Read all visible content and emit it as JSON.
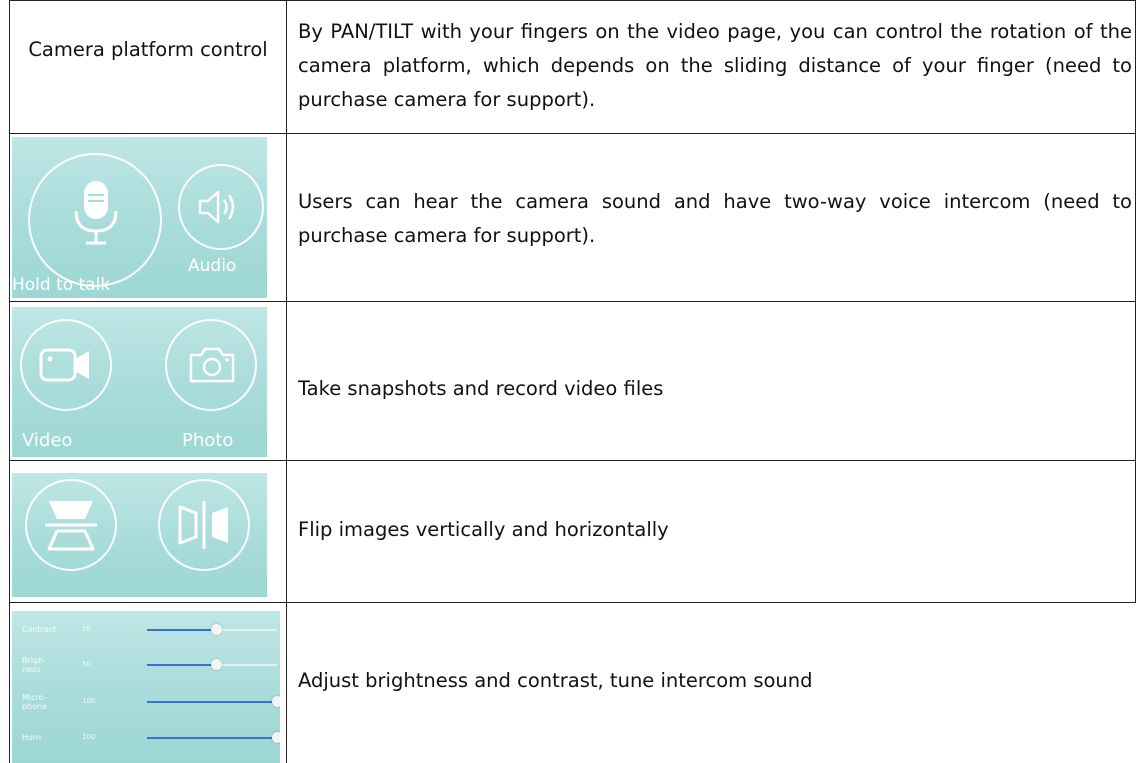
{
  "rows": [
    {
      "label": "Camera platform control",
      "description": "By PAN/TILT with your fingers on the video page, you can control the rotation of the camera platform, which depends on the sliding distance of your finger (need to purchase camera for support)."
    },
    {
      "panel": {
        "buttons": [
          {
            "icon": "microphone-icon",
            "label": "Hold to talk"
          },
          {
            "icon": "speaker-icon",
            "label": "Audio"
          }
        ]
      },
      "description": "Users can hear the camera sound and have two-way voice intercom (need to purchase camera for support)."
    },
    {
      "panel": {
        "buttons": [
          {
            "icon": "video-camera-icon",
            "label": "Video"
          },
          {
            "icon": "photo-camera-icon",
            "label": "Photo"
          }
        ]
      },
      "description": "Take snapshots and record video files"
    },
    {
      "panel": {
        "buttons": [
          {
            "icon": "flip-vertical-icon"
          },
          {
            "icon": "flip-horizontal-icon"
          }
        ]
      },
      "description": "Flip images vertically and horizontally"
    },
    {
      "panel": {
        "sliders": [
          {
            "label": "Contrast",
            "value": "50",
            "level": 0.5
          },
          {
            "label": "Brigh-\nness",
            "value": "50",
            "level": 0.5
          },
          {
            "label": "Micro-\nphone",
            "value": "100",
            "level": 1.0
          },
          {
            "label": "Horn",
            "value": "100",
            "level": 1.0
          }
        ]
      },
      "description": "Adjust brightness and contrast, tune intercom sound"
    }
  ],
  "colors": {
    "panel_bg": "#a8dcda",
    "slider_fill": "#3a6fd8",
    "border": "#222222"
  }
}
